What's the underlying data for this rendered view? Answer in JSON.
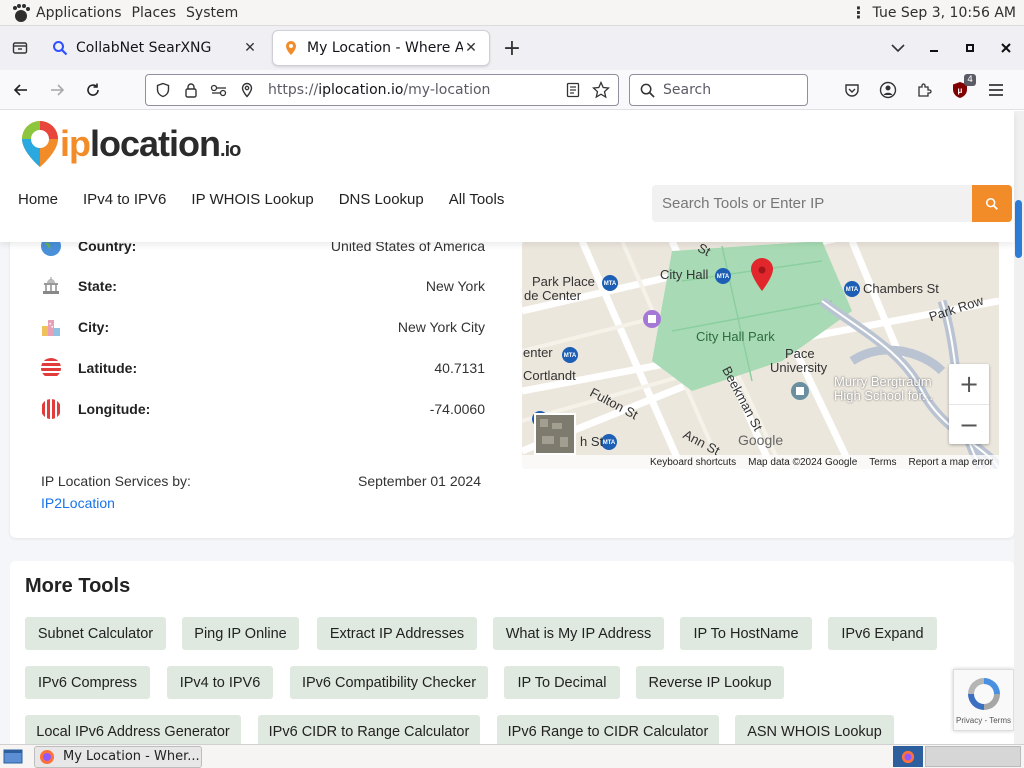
{
  "gnome_bar": {
    "applications": "Applications",
    "places": "Places",
    "system": "System",
    "clock": "Tue Sep  3, 10:56 AM"
  },
  "tabs": [
    {
      "title": "CollabNet SearXNG",
      "active": false
    },
    {
      "title": "My Location - Where Am I?",
      "active": true
    }
  ],
  "navbar": {
    "url_scheme": "https://",
    "url_host": "iplocation.io",
    "url_path": "/my-location",
    "search_placeholder": "Search",
    "ublock_count": "4"
  },
  "site": {
    "logo_ip": "ip",
    "logo_location": "location",
    "logo_tld": ".io",
    "nav": [
      "Home",
      "IPv4 to IPV6",
      "IP WHOIS Lookup",
      "DNS Lookup",
      "All Tools"
    ],
    "search_placeholder": "Search Tools or Enter IP"
  },
  "location": {
    "rows": [
      {
        "label": "Country:",
        "value": "United States of America"
      },
      {
        "label": "State:",
        "value": "New York"
      },
      {
        "label": "City:",
        "value": "New York City"
      },
      {
        "label": "Latitude:",
        "value": "40.7131"
      },
      {
        "label": "Longitude:",
        "value": "-74.0060"
      }
    ],
    "services_label": "IP Location Services by:",
    "services_link": "IP2Location",
    "services_date": "September 01 2024"
  },
  "map": {
    "labels": [
      "Park Place",
      "de Center",
      "City Hall",
      "Chambers St",
      "Park Row",
      "City Hall Park",
      "Pace",
      "University",
      "Murry Bergtraum",
      "High School for...",
      "enter",
      "Cortlandt",
      "Fulton St",
      "Beekman St",
      "Ann St",
      "h St",
      "St"
    ],
    "zoom_in": "+",
    "zoom_out": "−",
    "footer": [
      "Keyboard shortcuts",
      "Map data ©2024 Google",
      "Terms",
      "Report a map error"
    ],
    "google": "Google"
  },
  "more_tools": {
    "title": "More Tools",
    "chips": [
      "Subnet Calculator",
      "Ping IP Online",
      "Extract IP Addresses",
      "What is My IP Address",
      "IP To HostName",
      "IPv6 Expand",
      "IPv6 Compress",
      "IPv4 to IPV6",
      "IPv6 Compatibility Checker",
      "IP To Decimal",
      "Reverse IP Lookup",
      "Local IPv6 Address Generator",
      "IPv6 CIDR to Range Calculator",
      "IPv6 Range to CIDR Calculator",
      "ASN WHOIS Lookup"
    ]
  },
  "recaptcha": {
    "text": "Privacy - Terms"
  },
  "taskbar": {
    "task_title": "My Location - Wher..."
  },
  "colors": {
    "brand_orange": "#f28c28",
    "link_blue": "#1a73e8",
    "chip_green": "#dfe9df",
    "map_park": "#a8dbb5"
  }
}
